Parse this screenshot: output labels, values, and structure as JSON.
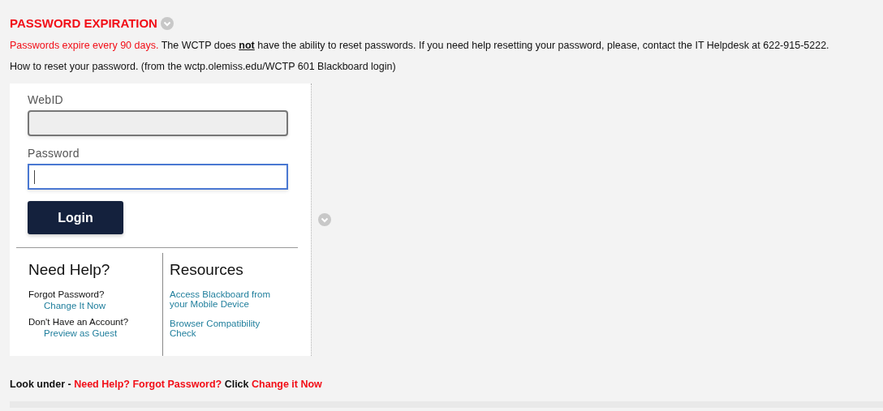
{
  "heading": {
    "title": "PASSWORD EXPIRATION"
  },
  "notice": [
    {
      "text": "Passwords expire every 90 days.",
      "highlight": true
    },
    {
      "text": "The WCTP does **not** have the ability to reset passwords. If you need help resetting your password, please, contact the IT Helpdesk at 622-915-5222.",
      "highlight": false
    }
  ],
  "how_to": "How to reset your password. (from the wctp.olemiss.edu/WCTP 601 Blackboard login)",
  "login": {
    "fields": [
      {
        "label": "WebID",
        "focused": false
      },
      {
        "label": "Password",
        "focused": true
      }
    ],
    "button": "Login",
    "help": {
      "title": "Need Help?",
      "items": [
        {
          "question": "Forgot Password?",
          "link": "Change It Now"
        },
        {
          "question": "Don't Have an Account?",
          "link": "Preview as Guest"
        }
      ]
    },
    "resources": {
      "title": "Resources",
      "links": [
        "Access Blackboard from your Mobile Device",
        "Browser Compatibility Check"
      ]
    }
  },
  "instruction": [
    {
      "text": "Look under -",
      "highlight": false
    },
    {
      "text": "Need Help? Forgot Password?",
      "highlight": true
    },
    {
      "text": "Click",
      "highlight": false
    },
    {
      "text": "Change it Now",
      "highlight": true
    }
  ]
}
